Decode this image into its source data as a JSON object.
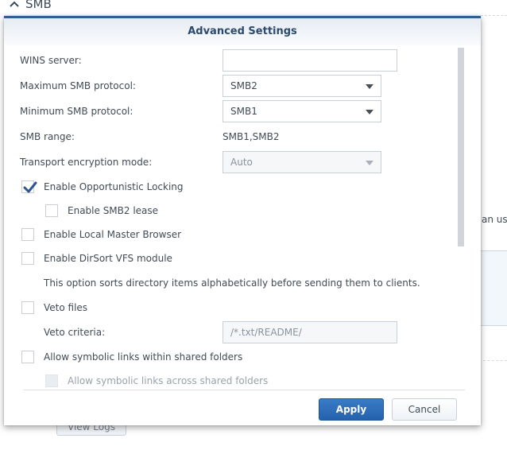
{
  "background": {
    "section_title": "SMB",
    "section_icon": "chevron-up-icon",
    "right_text": "an use",
    "view_logs_label": "View Logs"
  },
  "dialog": {
    "title": "Advanced Settings",
    "fields": {
      "wins_server": {
        "label": "WINS server:",
        "value": ""
      },
      "max_smb_protocol": {
        "label": "Maximum SMB protocol:",
        "value": "SMB2"
      },
      "min_smb_protocol": {
        "label": "Minimum SMB protocol:",
        "value": "SMB1"
      },
      "smb_range": {
        "label": "SMB range:",
        "value": "SMB1,SMB2"
      },
      "transport_encryption": {
        "label": "Transport encryption mode:",
        "value": "Auto"
      }
    },
    "checkboxes": {
      "opportunistic_locking": {
        "label": "Enable Opportunistic Locking",
        "checked": true
      },
      "smb2_lease": {
        "label": "Enable SMB2 lease",
        "checked": false
      },
      "local_master_browser": {
        "label": "Enable Local Master Browser",
        "checked": false
      },
      "dirsort_vfs": {
        "label": "Enable DirSort VFS module",
        "checked": false
      },
      "veto_files": {
        "label": "Veto files",
        "checked": false
      },
      "symlinks_within": {
        "label": "Allow symbolic links within shared folders",
        "checked": false
      },
      "symlinks_across": {
        "label": "Allow symbolic links across shared folders",
        "checked": false,
        "disabled": true
      }
    },
    "dirsort_description": "This option sorts directory items alphabetically before sending them to clients.",
    "veto_criteria": {
      "label": "Veto criteria:",
      "placeholder": "/*.txt/README/"
    },
    "buttons": {
      "apply": "Apply",
      "cancel": "Cancel"
    },
    "colors": {
      "accent": "#2f5f94",
      "primary_button": "#2a68b2",
      "checkmark": "#2f5591"
    }
  }
}
